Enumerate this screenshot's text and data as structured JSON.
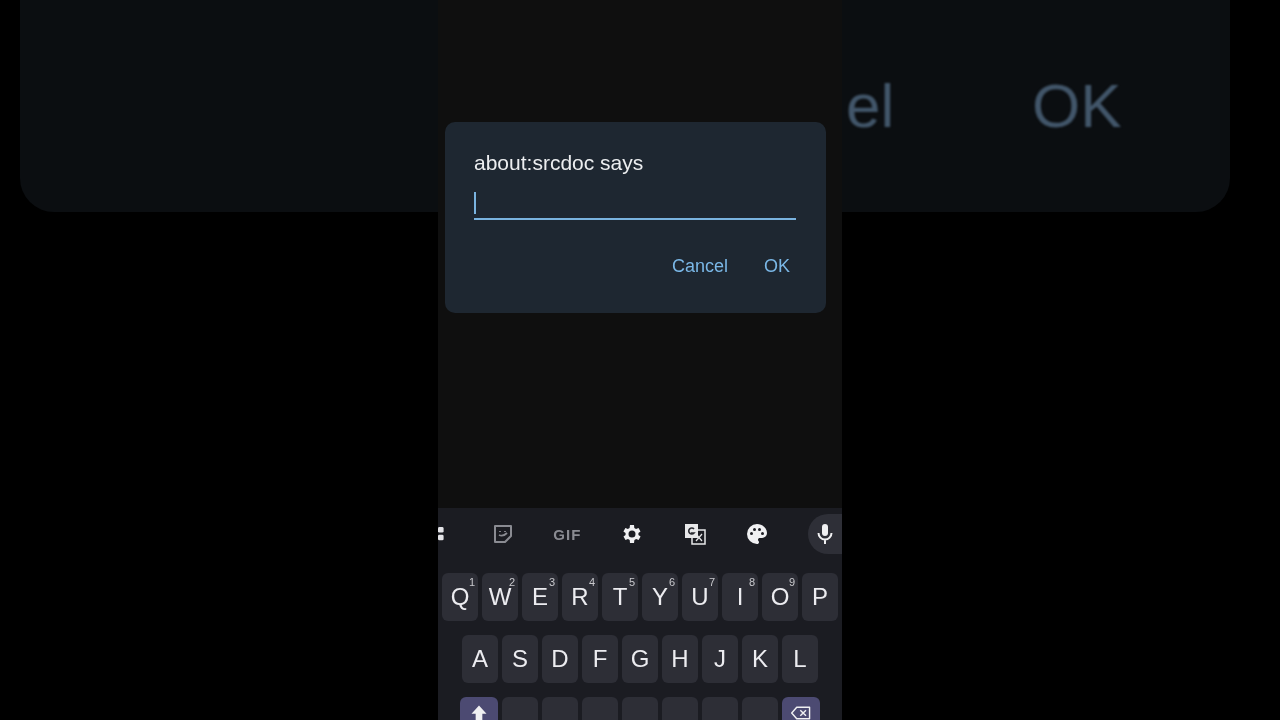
{
  "backdrop": {
    "texts": [
      "el",
      "OK"
    ]
  },
  "dialog": {
    "title": "about:srcdoc says",
    "input": {
      "focused": true
    },
    "buttons": [
      "Cancel",
      "OK"
    ]
  },
  "keyboard": {
    "toolbar": {
      "gif": "GIF"
    },
    "rows": [
      [
        {
          "kind": "letter",
          "label": "Q",
          "hint": "1"
        },
        {
          "kind": "letter",
          "label": "W",
          "hint": "2"
        },
        {
          "kind": "letter",
          "label": "E",
          "hint": "3"
        },
        {
          "kind": "letter",
          "label": "R",
          "hint": "4"
        },
        {
          "kind": "letter",
          "label": "T",
          "hint": "5"
        },
        {
          "kind": "letter",
          "label": "Y",
          "hint": "6"
        },
        {
          "kind": "letter",
          "label": "U",
          "hint": "7"
        },
        {
          "kind": "letter",
          "label": "I",
          "hint": "8"
        },
        {
          "kind": "letter",
          "label": "O",
          "hint": "9"
        },
        {
          "kind": "letter",
          "label": "P"
        }
      ],
      [
        {
          "kind": "letter",
          "label": "A"
        },
        {
          "kind": "letter",
          "label": "S"
        },
        {
          "kind": "letter",
          "label": "D"
        },
        {
          "kind": "letter",
          "label": "F"
        },
        {
          "kind": "letter",
          "label": "G"
        },
        {
          "kind": "letter",
          "label": "H"
        },
        {
          "kind": "letter",
          "label": "J"
        },
        {
          "kind": "letter",
          "label": "K"
        },
        {
          "kind": "letter",
          "label": "L"
        }
      ],
      [
        {
          "kind": "shift"
        },
        {
          "kind": "blank"
        },
        {
          "kind": "blank"
        },
        {
          "kind": "blank"
        },
        {
          "kind": "blank"
        },
        {
          "kind": "blank"
        },
        {
          "kind": "blank"
        },
        {
          "kind": "blank"
        },
        {
          "kind": "backspace"
        }
      ]
    ]
  }
}
